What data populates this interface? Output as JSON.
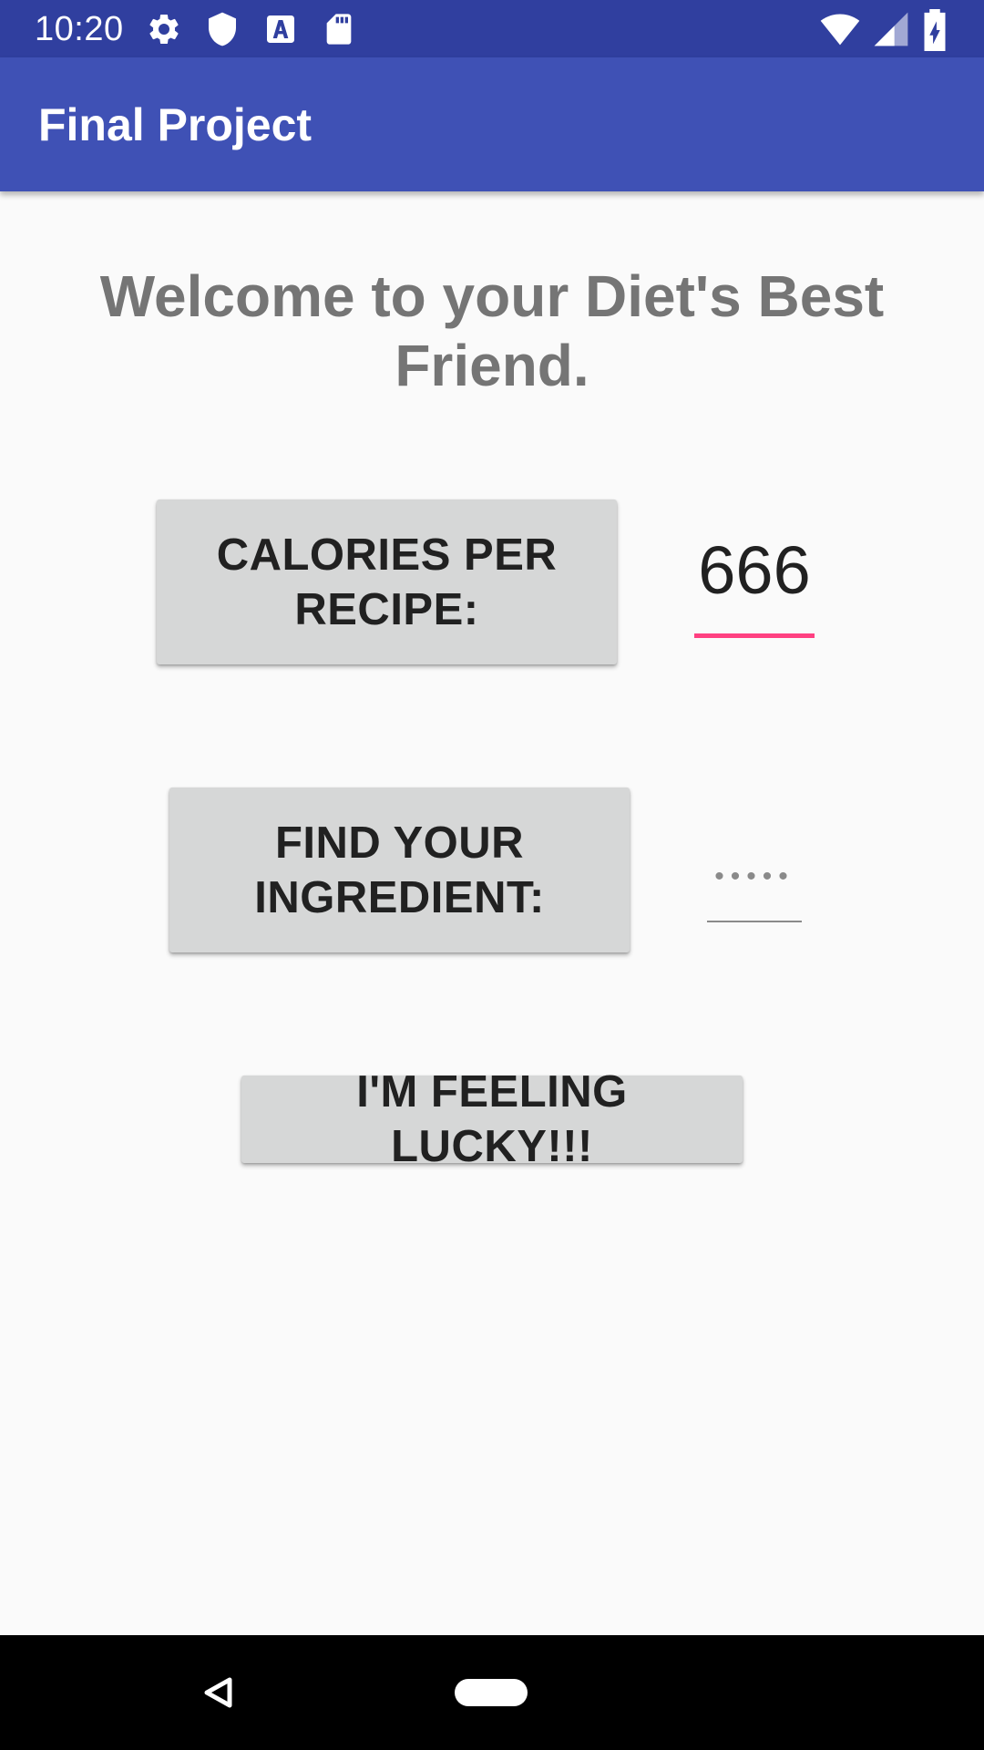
{
  "status_bar": {
    "time": "10:20",
    "icons": [
      "gear-icon",
      "shield-icon",
      "font-a-icon",
      "sd-card-icon",
      "wifi-icon",
      "signal-icon",
      "battery-charging-icon"
    ]
  },
  "app_bar": {
    "title": "Final Project"
  },
  "main": {
    "welcome": "Welcome to your Diet's Best Friend.",
    "calories_button": "CALORIES PER RECIPE:",
    "calories_value": "666",
    "ingredient_button": "FIND YOUR INGREDIENT:",
    "ingredient_value": "•••••",
    "lucky_button": "I'M FEELING LUCKY!!!"
  },
  "nav_bar": {
    "icons": [
      "back-icon",
      "home-icon"
    ]
  },
  "colors": {
    "status_bar": "#303f9f",
    "app_bar": "#3f51b5",
    "accent": "#ff4081",
    "button_bg": "#d6d7d7"
  }
}
